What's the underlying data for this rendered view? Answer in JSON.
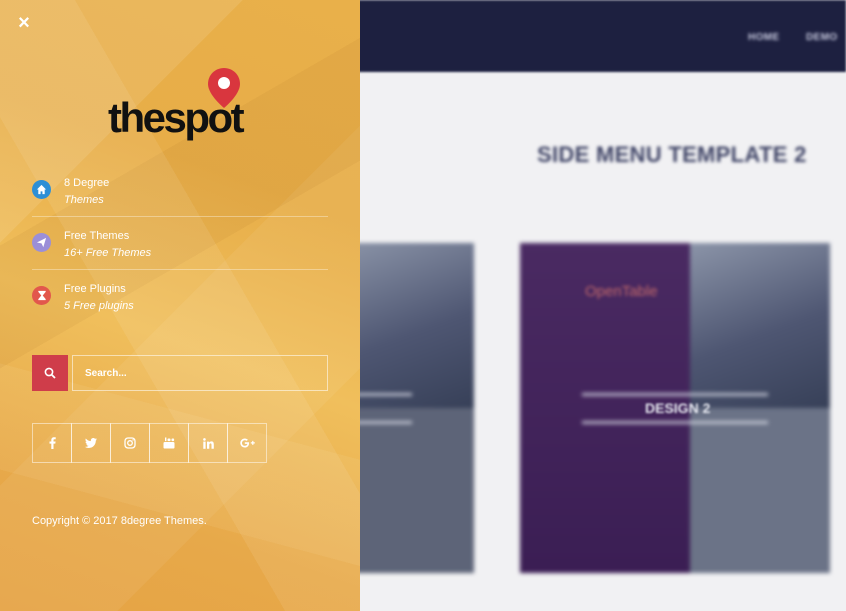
{
  "background": {
    "nav": [
      "HOME",
      "DEMO"
    ],
    "title": "SIDE MENU TEMPLATE 2",
    "card_label": "DESIGN 2",
    "card_brand": "OpenTable"
  },
  "sidepanel": {
    "close_label": "×",
    "logo_text": "thespot",
    "menu": [
      {
        "title": "8 Degree",
        "subtitle": "Themes",
        "icon": "home-icon",
        "color": "#2d8fd6"
      },
      {
        "title": "Free Themes",
        "subtitle": "16+ Free Themes",
        "icon": "send-icon",
        "color": "#9b8fd8"
      },
      {
        "title": "Free Plugins",
        "subtitle": "5 Free plugins",
        "icon": "hourglass-icon",
        "color": "#e2574c"
      }
    ],
    "search": {
      "placeholder": "Search..."
    },
    "social": [
      {
        "name": "facebook-icon",
        "glyph": "f"
      },
      {
        "name": "twitter-icon",
        "glyph": "t"
      },
      {
        "name": "instagram-icon",
        "glyph": "ig"
      },
      {
        "name": "youtube-icon",
        "glyph": "yt"
      },
      {
        "name": "linkedin-icon",
        "glyph": "in"
      },
      {
        "name": "google-plus-icon",
        "glyph": "G+"
      }
    ],
    "copyright": "Copyright © 2017 8degree Themes."
  },
  "colors": {
    "accent": "#cf3d4a",
    "panel": "#e9b04a",
    "nav": "#1d2040"
  }
}
